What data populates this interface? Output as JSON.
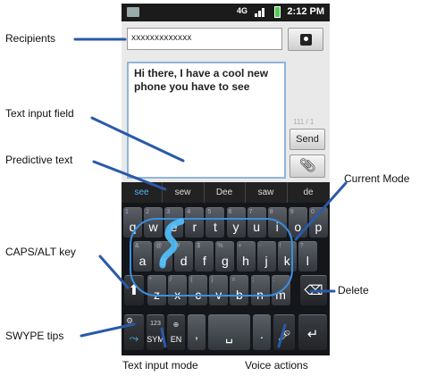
{
  "status": {
    "network": "4G",
    "time": "2:12 PM"
  },
  "compose": {
    "recipients": "xxxxxxxxxxxxx",
    "message": "Hi there, I have a cool new phone you have to see",
    "counter": "111 / 1",
    "send_label": "Send",
    "attach_icon": "paperclip-icon",
    "contacts_icon": "contact-card-icon"
  },
  "predictions": [
    "see",
    "sew",
    "Dee",
    "saw",
    "de"
  ],
  "keyboard": {
    "row1": [
      {
        "k": "q",
        "s": "1"
      },
      {
        "k": "w",
        "s": "2"
      },
      {
        "k": "e",
        "s": "3"
      },
      {
        "k": "r",
        "s": "4"
      },
      {
        "k": "t",
        "s": "5"
      },
      {
        "k": "y",
        "s": "6"
      },
      {
        "k": "u",
        "s": "7"
      },
      {
        "k": "i",
        "s": "8"
      },
      {
        "k": "o",
        "s": "9"
      },
      {
        "k": "p",
        "s": "0"
      }
    ],
    "row2": [
      {
        "k": "a",
        "s": "&"
      },
      {
        "k": "s",
        "s": "@"
      },
      {
        "k": "d",
        "s": "#"
      },
      {
        "k": "f",
        "s": "$"
      },
      {
        "k": "g",
        "s": "%"
      },
      {
        "k": "h",
        "s": "+"
      },
      {
        "k": "j",
        "s": "-"
      },
      {
        "k": "k",
        "s": "!"
      },
      {
        "k": "l",
        "s": "?"
      }
    ],
    "row3": [
      {
        "k": "z",
        "s": "*"
      },
      {
        "k": "x",
        "s": "/"
      },
      {
        "k": "c",
        "s": "("
      },
      {
        "k": "v",
        "s": ")"
      },
      {
        "k": "b",
        "s": "="
      },
      {
        "k": "n",
        "s": ";"
      },
      {
        "k": "m",
        "s": ":"
      }
    ],
    "shift_icon": "shift-arrow-icon",
    "delete_icon": "backspace-icon",
    "swype_key_icon": "swype-icon",
    "mode_key": {
      "top": "123",
      "main": "SYM"
    },
    "lang_key": {
      "top": "⊕",
      "main": "EN"
    },
    "comma": ",",
    "space_icon": "space-bar-icon",
    "period": ".",
    "mic_icon": "microphone-icon",
    "enter_icon": "enter-icon"
  },
  "callouts": {
    "recipients": "Recipients",
    "text_input_field": "Text input field",
    "predictive_text": "Predictive text",
    "caps_alt": "CAPS/ALT key",
    "swype_tips": "SWYPE tips",
    "text_input_mode": "Text input mode",
    "voice_actions": "Voice actions",
    "delete": "Delete",
    "current_mode": "Current Mode"
  },
  "colors": {
    "accent": "#3a8fe0",
    "trace": "#52c2ff"
  }
}
